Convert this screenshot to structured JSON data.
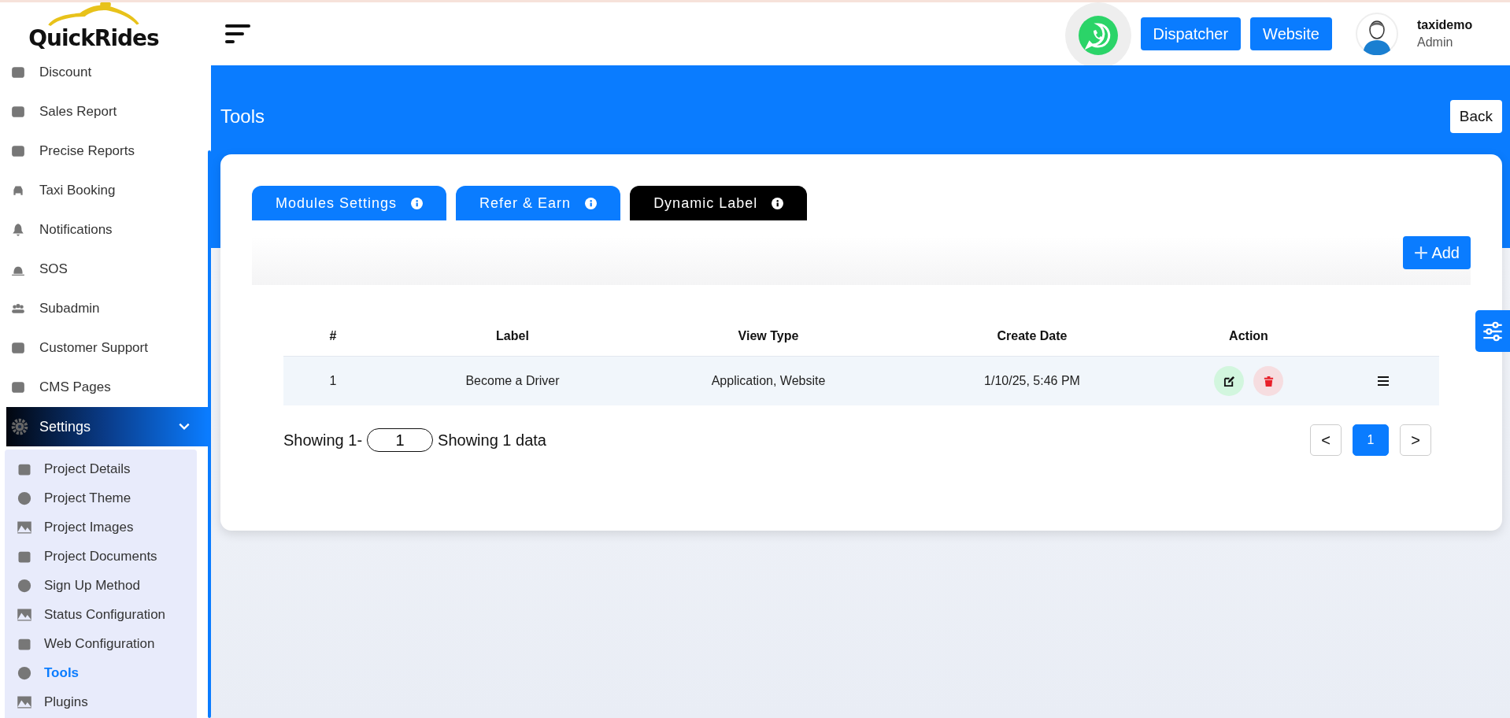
{
  "sidebar": {
    "logo": "QuickRides",
    "items": [
      {
        "label": "Discount"
      },
      {
        "label": "Sales Report"
      },
      {
        "label": "Precise Reports"
      },
      {
        "label": "Taxi Booking"
      },
      {
        "label": "Notifications"
      },
      {
        "label": "SOS"
      },
      {
        "label": "Subadmin"
      },
      {
        "label": "Customer Support"
      },
      {
        "label": "CMS Pages"
      }
    ],
    "settings": {
      "label": "Settings",
      "expanded": true,
      "children": [
        {
          "label": "Project Details",
          "selected": false
        },
        {
          "label": "Project Theme",
          "selected": false
        },
        {
          "label": "Project Images",
          "selected": false
        },
        {
          "label": "Project Documents",
          "selected": false
        },
        {
          "label": "Sign Up Method",
          "selected": false
        },
        {
          "label": "Status Configuration",
          "selected": false
        },
        {
          "label": "Web Configuration",
          "selected": false
        },
        {
          "label": "Tools",
          "selected": true
        },
        {
          "label": "Plugins",
          "selected": false
        }
      ]
    }
  },
  "header": {
    "buttons": [
      "Dispatcher",
      "Website"
    ],
    "user": {
      "name": "taxidemo",
      "role": "Admin"
    }
  },
  "page": {
    "title": "Tools",
    "back": "Back"
  },
  "tabs": [
    {
      "label": "Modules Settings",
      "selected": false
    },
    {
      "label": "Refer & Earn",
      "selected": false
    },
    {
      "label": "Dynamic Label",
      "selected": true
    }
  ],
  "add_button": "Add",
  "table": {
    "columns": [
      "#",
      "Label",
      "View Type",
      "Create Date",
      "Action"
    ],
    "rows": [
      {
        "cells": [
          "1",
          "Become a Driver",
          "Application, Website",
          "1/10/25, 5:46 PM"
        ]
      }
    ]
  },
  "pagination": {
    "prefix": "Showing 1-",
    "page_size": "1",
    "suffix": "Showing 1 data",
    "prev": "<",
    "next": ">",
    "pages": [
      {
        "label": "1",
        "selected": true
      }
    ]
  }
}
